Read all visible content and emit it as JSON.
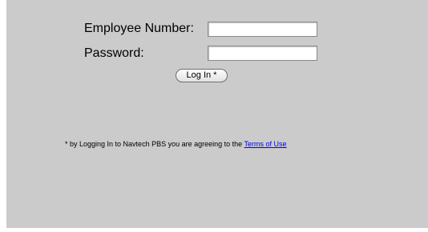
{
  "login_form": {
    "employee_number_label": "Employee Number:",
    "employee_number_value": "",
    "password_label": "Password:",
    "password_value": "",
    "login_button_label": "Log In *"
  },
  "terms": {
    "notice_text": "* by Logging In to Navtech PBS you are agreeing to the",
    "link_text": "Terms of Use"
  },
  "colors": {
    "panel_background": "#cbcbcb",
    "link": "#0000ee"
  }
}
